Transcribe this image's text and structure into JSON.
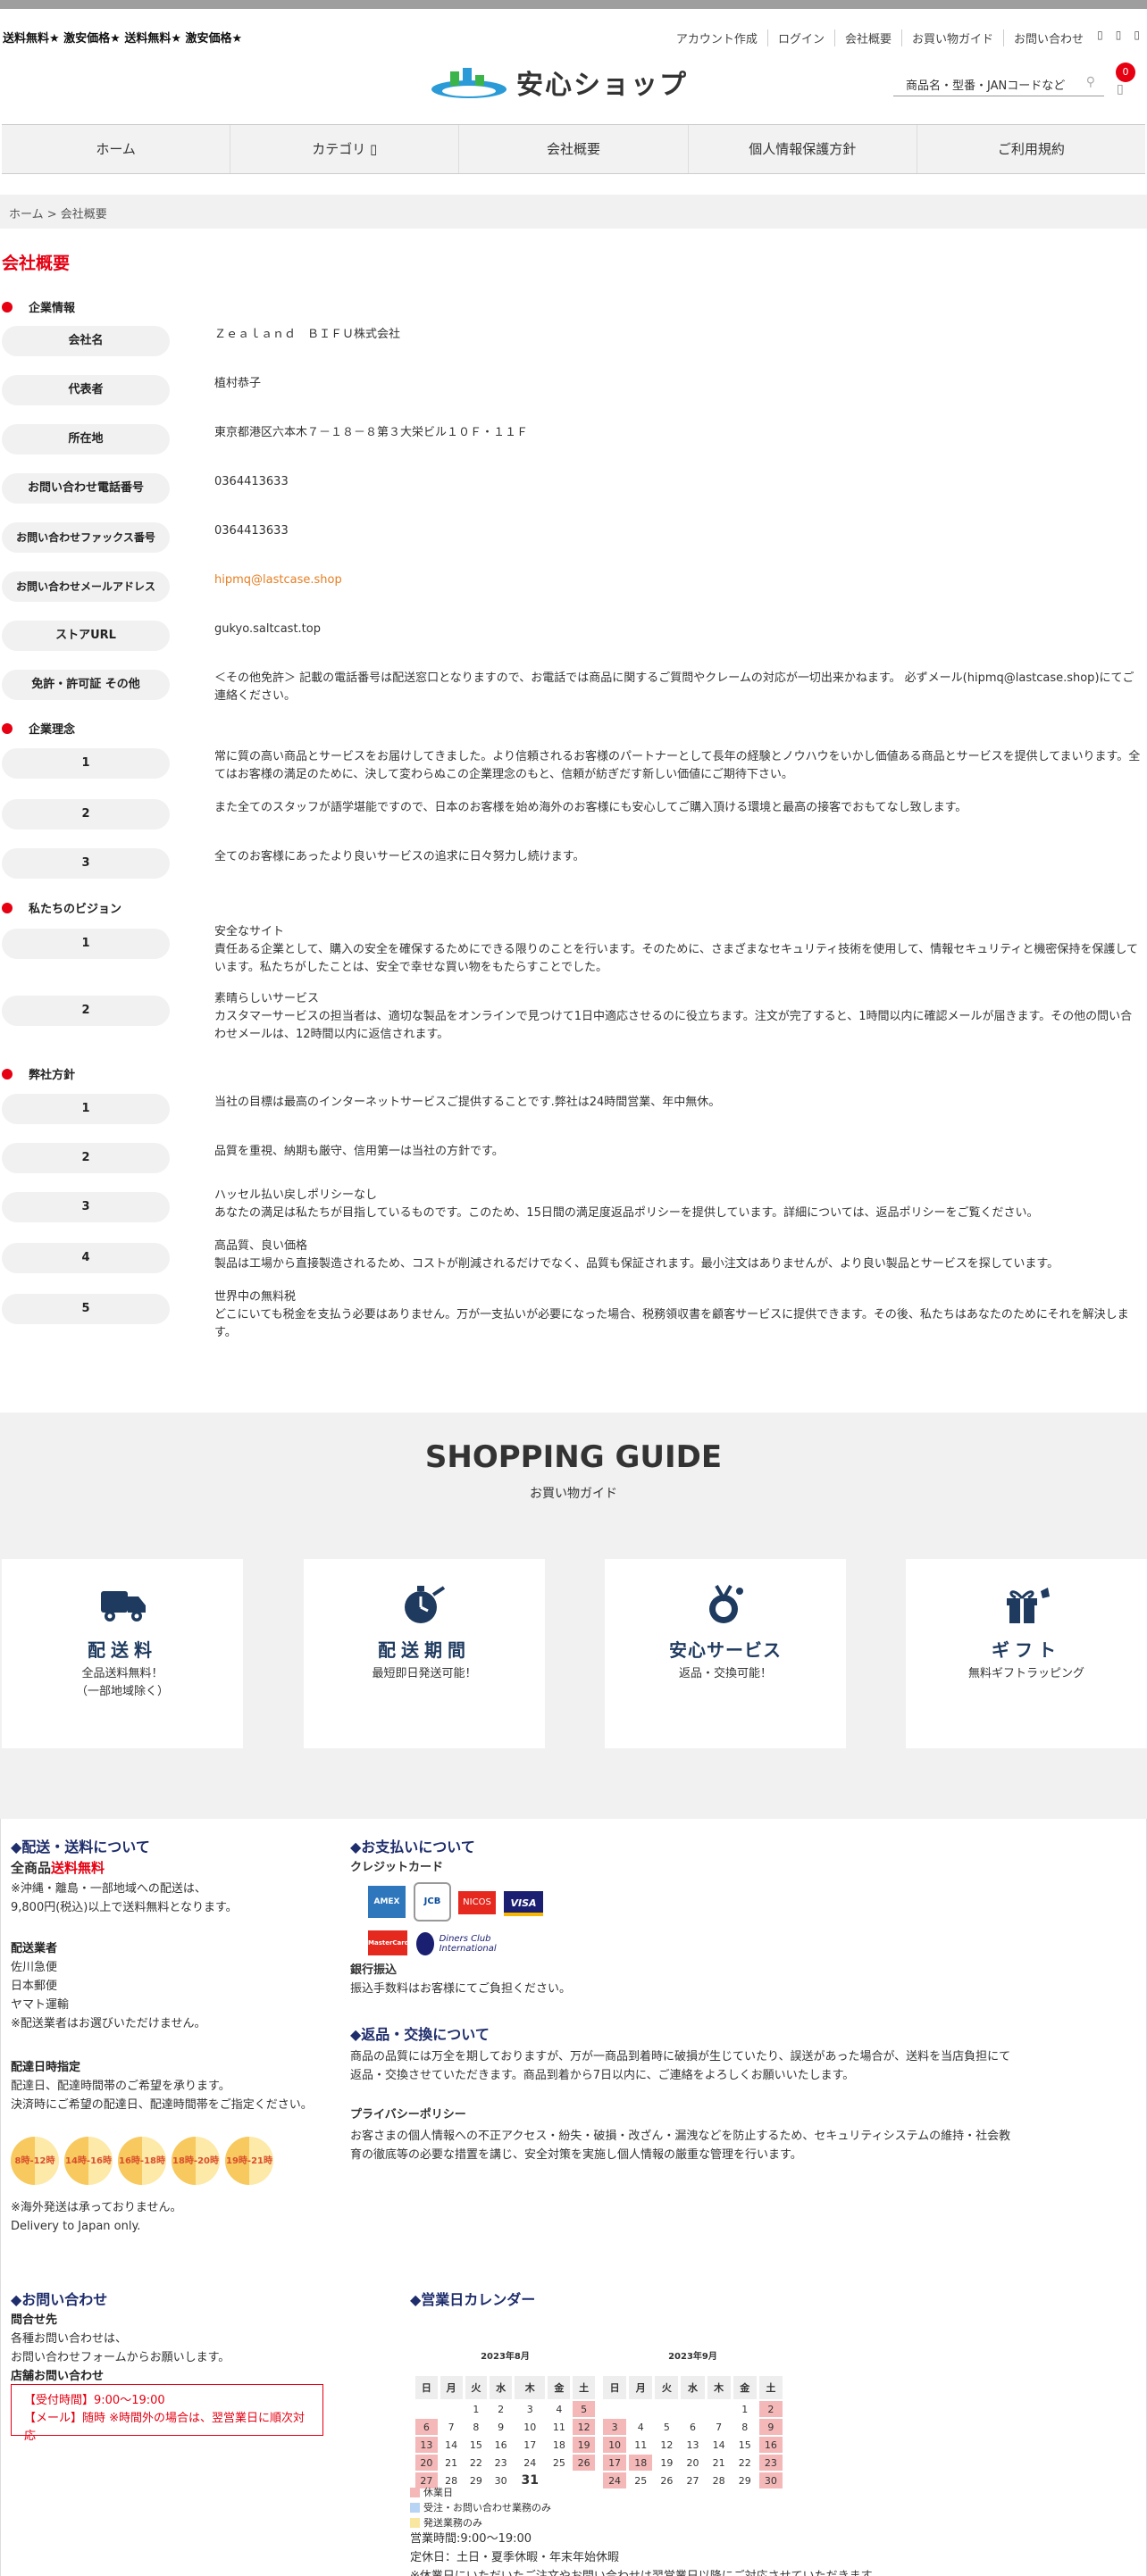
{
  "header": {
    "marquee": "送料無料★ 激安価格★ 送料無料★ 激安価格★",
    "links": [
      "アカウント作成",
      "ログイン",
      "会社概要",
      "お買い物ガイド",
      "お問い合わせ"
    ],
    "logo_text": "安心ショップ",
    "search_placeholder": "商品名・型番・JANコードなど",
    "cart_count": "0"
  },
  "nav": [
    "ホーム",
    "カテゴリ ▯",
    "会社概要",
    "個人情報保護方針",
    "ご利用規約"
  ],
  "breadcrumb": "ホーム > 会社概要",
  "page_title": "会社概要",
  "sections": {
    "company_info": "企業情報",
    "philosophy": "企業理念",
    "vision": "私たちのビジョン",
    "policy": "弊社方針"
  },
  "company": [
    {
      "label": "会社名",
      "value": "Ｚｅａｌａｎｄ　ＢＩＦＵ株式会社"
    },
    {
      "label": "代表者",
      "value": "植村恭子"
    },
    {
      "label": "所在地",
      "value": "東京都港区六本木７－１８－８第３大栄ビル１０Ｆ・１１Ｆ"
    },
    {
      "label": "お問い合わせ電話番号",
      "value": "0364413633"
    },
    {
      "label": "お問い合わせファックス番号",
      "value": "0364413633"
    },
    {
      "label": "お問い合わせメールアドレス",
      "value": "hipmq@lastcase.shop"
    },
    {
      "label": "ストアURL",
      "value": "gukyo.saltcast.top"
    },
    {
      "label": "免許・許可証 その他",
      "value": "＜その他免許＞ 記載の電話番号は配送窓口となりますので、お電話では商品に関するご質問やクレームの対応が一切出来かねます。 必ずメール(hipmq@lastcase.shop)にてご連絡ください。"
    }
  ],
  "philosophy": [
    {
      "label": "1",
      "value": "常に質の高い商品とサービスをお届けしてきました。より信頼されるお客様のパートナーとして長年の経験とノウハウをいかし価値ある商品とサービスを提供してまいります。全てはお客様の満足のために、決して変わらぬこの企業理念のもと、信頼が紡ぎだす新しい価値にご期待下さい。"
    },
    {
      "label": "2",
      "value": "また全てのスタッフが語学堪能ですので、日本のお客様を始め海外のお客様にも安心してご購入頂ける環境と最高の接客でおもてなし致します。"
    },
    {
      "label": "3",
      "value": "全てのお客様にあったより良いサービスの追求に日々努力し続けます。"
    }
  ],
  "vision": [
    {
      "label": "1",
      "value": "安全なサイト\n責任ある企業として、購入の安全を確保するためにできる限りのことを行います。そのために、さまざまなセキュリティ技術を使用して、情報セキュリティと機密保持を保護しています。私たちがしたことは、安全で幸せな買い物をもたらすことでした。"
    },
    {
      "label": "2",
      "value": "素晴らしいサービス\nカスタマーサービスの担当者は、適切な製品をオンラインで見つけて1日中適応させるのに役立ちます。注文が完了すると、1時間以内に確認メールが届きます。その他の問い合わせメールは、12時間以内に返信されます。"
    }
  ],
  "policy": [
    {
      "label": "1",
      "value": "当社の目標は最高のインターネットサービスご提供することです.弊社は24時間営業、年中無休。"
    },
    {
      "label": "2",
      "value": "品質を重視、納期も厳守、信用第一は当社の方針です。"
    },
    {
      "label": "3",
      "value": "ハッセル払い戻しポリシーなし\nあなたの満足は私たちが目指しているものです。このため、15日間の満足度返品ポリシーを提供しています。詳細については、返品ポリシーをご覧ください。"
    },
    {
      "label": "4",
      "value": "高品質、良い価格\n製品は工場から直接製造されるため、コストが削減されるだけでなく、品質も保証されます。最小注文はありませんが、より良い製品とサービスを探しています。"
    },
    {
      "label": "5",
      "value": "世界中の無料税\nどこにいても税金を支払う必要はありません。万が一支払いが必要になった場合、税務領収書を顧客サービスに提供できます。その後、私たちはあなたのためにそれを解決します。"
    }
  ],
  "guide": {
    "title": "SHOPPING GUIDE",
    "subtitle": "お買い物ガイド",
    "cards": [
      {
        "title": "配送料",
        "desc1": "全品送料無料！",
        "desc2": "（一部地域除く）",
        "icon": "truck-icon"
      },
      {
        "title": "配送期間",
        "desc1": "最短即日発送可能！",
        "desc2": "",
        "icon": "stopwatch-icon"
      },
      {
        "title": "安心サービス",
        "desc1": "返品・交換可能！",
        "desc2": "",
        "icon": "service-icon"
      },
      {
        "title": "ギフト",
        "desc1": "無料ギフトラッピング",
        "desc2": "",
        "icon": "gift-icon"
      }
    ]
  },
  "footer": {
    "shipping": {
      "heading": "◆配送・送料について",
      "line1_a": "全商品",
      "line1_b": "送料無料",
      "line2": "※沖縄・離島・一部地域への配送は、",
      "line3": "9,800円(税込)以上で送料無料となります。",
      "carrier_h": "配送業者",
      "carriers": [
        "佐川急便",
        "日本郵便",
        "ヤマト運輸"
      ],
      "carrier_note": "※配送業者はお選びいただけません。",
      "time_h": "配達日時指定",
      "time1": "配達日、配達時間帯のご希望を承ります。",
      "time2": "決済時にご希望の配達日、配達時間帯をご指定ください。",
      "slots": [
        "8時-12時",
        "14時-16時",
        "16時-18時",
        "18時-20時",
        "19時-21時"
      ],
      "overseas1": "※海外発送は承っておりません。",
      "overseas2": "Delivery to Japan only."
    },
    "payment": {
      "heading": "◆お支払いについて",
      "card_h": "クレジットカード",
      "cards": [
        "AMEX",
        "JCB",
        "NICOS",
        "VISA",
        "MasterCard",
        "Diners Club International"
      ],
      "bank_h": "銀行振込",
      "bank": "振込手数料はお客様にてご負担ください。"
    },
    "returns": {
      "heading": "◆返品・交換について",
      "t1": "商品の品質には万全を期しておりますが、万が一商品到着時に破損が生じていたり、誤送があった場合が、送料を当店負担にて",
      "t2": "返品・交換させていただきます。商品到着から7日以内に、ご連絡をよろしくお願いいたします。",
      "privacy_h": "プライバシーポリシー",
      "p1": "お客さまの個人情報への不正アクセス・紛失・破損・改ざん・漏洩などを防止するため、セキュリティシステムの維持・社会教",
      "p2": "育の徹底等の必要な措置を講じ、安全対策を実施し個人情報の厳重な管理を行います。"
    },
    "contact": {
      "heading": "◆お問い合わせ",
      "h1": "問合せ先",
      "t1": "各種お問い合わせは、",
      "t2": "お問い合わせフォームからお願いします。",
      "h2": "店舗お問い合わせ",
      "box1": "【受付時間】9:00〜19:00",
      "box2": "【メール】随時 ※時間外の場合は、翌営業日に順次対応"
    },
    "calendar": {
      "heading": "◆営業日カレンダー",
      "weekdays": [
        "日",
        "月",
        "火",
        "水",
        "木",
        "金",
        "土"
      ],
      "months": [
        {
          "title": "2023年8月",
          "weeks": [
            [
              "",
              "",
              "1",
              "2",
              "3",
              "4",
              "5"
            ],
            [
              "6",
              "7",
              "8",
              "9",
              "10",
              "11",
              "12"
            ],
            [
              "13",
              "14",
              "15",
              "16",
              "17",
              "18",
              "19"
            ],
            [
              "20",
              "21",
              "22",
              "23",
              "24",
              "25",
              "26"
            ],
            [
              "27",
              "28",
              "29",
              "30",
              "31",
              "",
              ""
            ]
          ],
          "holidays": [
            "5",
            "6",
            "12",
            "13",
            "19",
            "20",
            "26",
            "27"
          ],
          "today": "31"
        },
        {
          "title": "2023年9月",
          "weeks": [
            [
              "",
              "",
              "",
              "",
              "",
              "1",
              "2"
            ],
            [
              "3",
              "4",
              "5",
              "6",
              "7",
              "8",
              "9"
            ],
            [
              "10",
              "11",
              "12",
              "13",
              "14",
              "15",
              "16"
            ],
            [
              "17",
              "18",
              "19",
              "20",
              "21",
              "22",
              "23"
            ],
            [
              "24",
              "25",
              "26",
              "27",
              "28",
              "29",
              "30"
            ]
          ],
          "holidays": [
            "2",
            "3",
            "9",
            "10",
            "16",
            "17",
            "18",
            "23",
            "24",
            "30"
          ],
          "today": ""
        }
      ],
      "legend": [
        {
          "label": "休業日",
          "color": "#f4b8b8"
        },
        {
          "label": "受注・お問い合わせ業務のみ",
          "color": "#b8d4f4"
        },
        {
          "label": "発送業務のみ",
          "color": "#f9e79f"
        }
      ],
      "hours": "営業時間:9:00〜19:00",
      "closed": "定休日：土日・夏季休暇・年末年始休暇",
      "note": "※休業日にいただいたご注文やお問い合わせは翌営業日以降にご対応させていただきます。"
    }
  }
}
